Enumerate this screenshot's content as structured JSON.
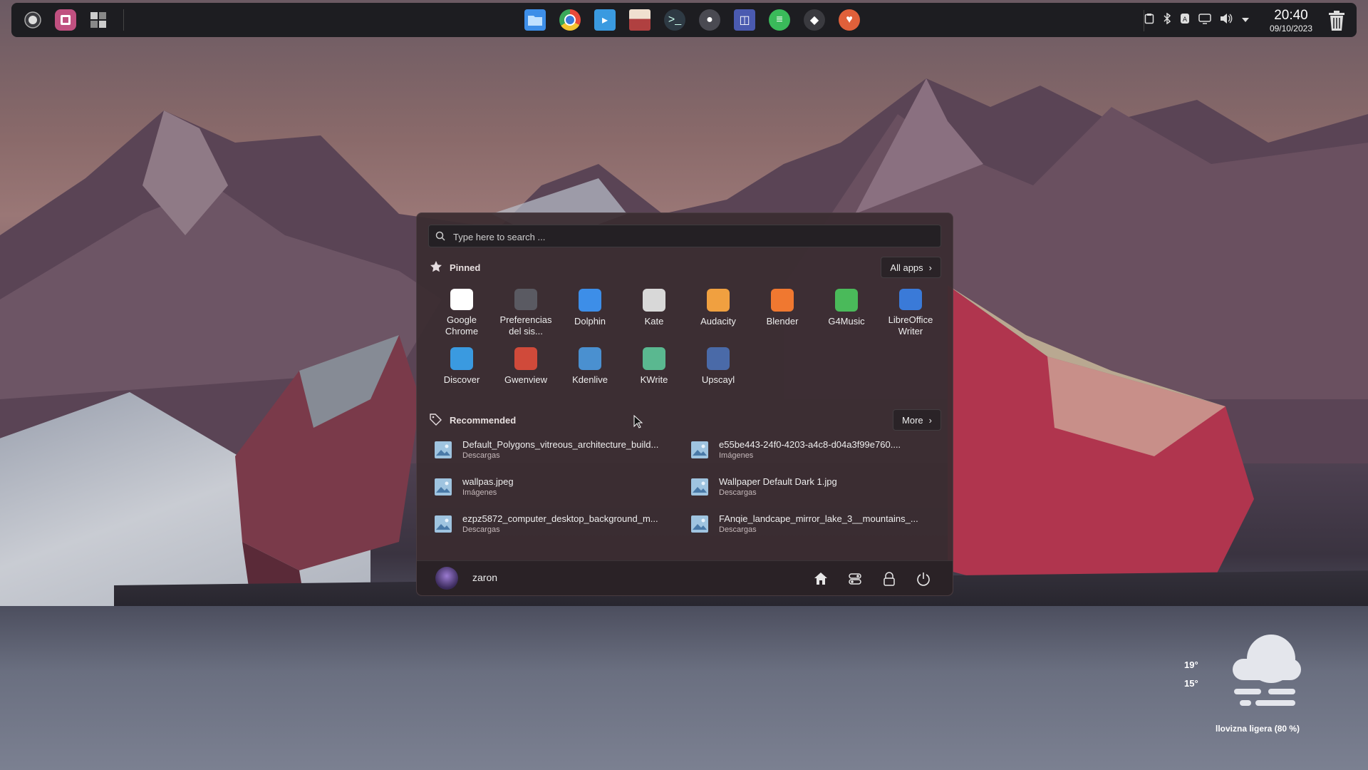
{
  "taskbar": {
    "left_icons": [
      "record-icon",
      "puzzle-icon",
      "window-grid-icon"
    ],
    "dock_icons": [
      "folder-icon",
      "chrome-icon",
      "discover-icon",
      "gwenview-icon",
      "terminal-icon",
      "settings-icon",
      "vpn-icon",
      "spotify-icon",
      "git-icon",
      "firefox-icon"
    ],
    "tray_icons": [
      "clipboard-icon",
      "bluetooth-icon",
      "keyboard-icon",
      "display-icon",
      "volume-icon",
      "expand-icon"
    ],
    "clock": {
      "time": "20:40",
      "date": "09/10/2023"
    },
    "trash_icon": "trash-icon"
  },
  "start_menu": {
    "search": {
      "placeholder": "Type here to search ..."
    },
    "pinned": {
      "title": "Pinned",
      "all_apps_label": "All apps",
      "apps": [
        {
          "label": "Google Chrome",
          "icon": "chrome-icon",
          "color": "#ffffff"
        },
        {
          "label": "Preferencias del sis...",
          "icon": "settings-icon",
          "color": "#5a5a62"
        },
        {
          "label": "Dolphin",
          "icon": "folder-icon",
          "color": "#3d8ee8"
        },
        {
          "label": "Kate",
          "icon": "pen-icon",
          "color": "#d8d8d8"
        },
        {
          "label": "Audacity",
          "icon": "headphones-icon",
          "color": "#f0a040"
        },
        {
          "label": "Blender",
          "icon": "blender-icon",
          "color": "#f07830"
        },
        {
          "label": "G4Music",
          "icon": "music-icon",
          "color": "#4aba5a"
        },
        {
          "label": "LibreOffice Writer",
          "icon": "document-icon",
          "color": "#3a7ad8"
        },
        {
          "label": "Discover",
          "icon": "discover-icon",
          "color": "#3a9ae0"
        },
        {
          "label": "Gwenview",
          "icon": "gwenview-icon",
          "color": "#d04a3a"
        },
        {
          "label": "Kdenlive",
          "icon": "kdenlive-icon",
          "color": "#4a90d0"
        },
        {
          "label": "KWrite",
          "icon": "kwrite-icon",
          "color": "#5ab890"
        },
        {
          "label": "Upscayl",
          "icon": "upscayl-icon",
          "color": "#4a6aa8"
        }
      ]
    },
    "recommended": {
      "title": "Recommended",
      "more_label": "More",
      "items": [
        {
          "name": "Default_Polygons_vitreous_architecture_build...",
          "location": "Descargas"
        },
        {
          "name": "e55be443-24f0-4203-a4c8-d04a3f99e760....",
          "location": "Imágenes"
        },
        {
          "name": "wallpas.jpeg",
          "location": "Imágenes"
        },
        {
          "name": "Wallpaper Default Dark 1.jpg",
          "location": "Descargas"
        },
        {
          "name": "ezpz5872_computer_desktop_background_m...",
          "location": "Descargas"
        },
        {
          "name": "FAnqie_landcape_mirror_lake_3__mountains_...",
          "location": "Descargas"
        }
      ]
    },
    "footer": {
      "username": "zaron",
      "actions": [
        "home-icon",
        "settings-toggle-icon",
        "lock-icon",
        "power-icon"
      ]
    }
  },
  "weather": {
    "high": "19°",
    "low": "15°",
    "description": "llovizna ligera (80 %)"
  }
}
